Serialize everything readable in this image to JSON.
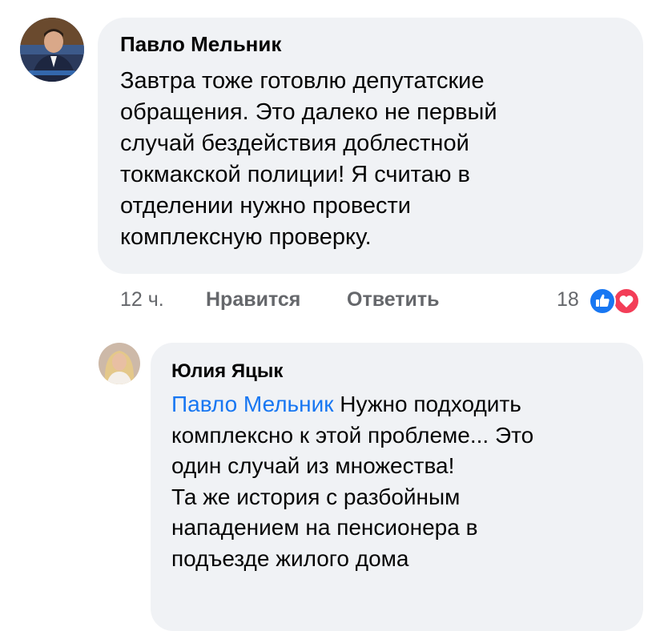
{
  "comments": [
    {
      "author": "Павло Мельник",
      "text": "Завтра тоже готовлю депутатские\nобращения. Это далеко не первый\nслучай бездействия доблестной\nтокмакской полиции! Я считаю в\nотделении нужно провести\nкомплексную проверку.",
      "time": "12 ч.",
      "like_label": "Нравится",
      "reply_label": "Ответить",
      "reaction_count": "18",
      "reactions": [
        "like-icon",
        "love-icon"
      ]
    }
  ],
  "reply": {
    "author": "Юлия Яцык",
    "mention": "Павло Мельник",
    "text": " Нужно подходить\nкомплексно к этой проблеме... Это\nодин случай из множества!\nТа же история  с разбойным\nнападением на пенсионера в\nподъезде жилого дома"
  },
  "colors": {
    "bubble": "#f0f2f5",
    "mention": "#1877f2",
    "like": "#1877f2",
    "love": "#f33e58",
    "meta": "#65676b"
  }
}
